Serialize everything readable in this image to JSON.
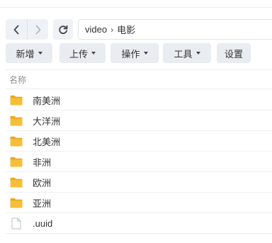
{
  "nav": {
    "back_icon": "chevron-left-icon",
    "forward_icon": "chevron-right-icon",
    "refresh_icon": "refresh-icon"
  },
  "path": {
    "segments": [
      "video",
      "电影"
    ],
    "separator": "›"
  },
  "toolbar": {
    "new_label": "新增",
    "upload_label": "上传",
    "action_label": "操作",
    "tools_label": "工具",
    "settings_label": "设置"
  },
  "list": {
    "column_name": "名称",
    "items": [
      {
        "name": "南美洲",
        "type": "folder"
      },
      {
        "name": "大洋洲",
        "type": "folder"
      },
      {
        "name": "北美洲",
        "type": "folder"
      },
      {
        "name": "非洲",
        "type": "folder"
      },
      {
        "name": "欧洲",
        "type": "folder"
      },
      {
        "name": "亚洲",
        "type": "folder"
      },
      {
        "name": ".uuid",
        "type": "file"
      }
    ]
  },
  "colors": {
    "folder": "#f6bf3a",
    "folder_tab": "#eba91f",
    "button_bg": "#e9ecf0",
    "text": "#333333"
  }
}
